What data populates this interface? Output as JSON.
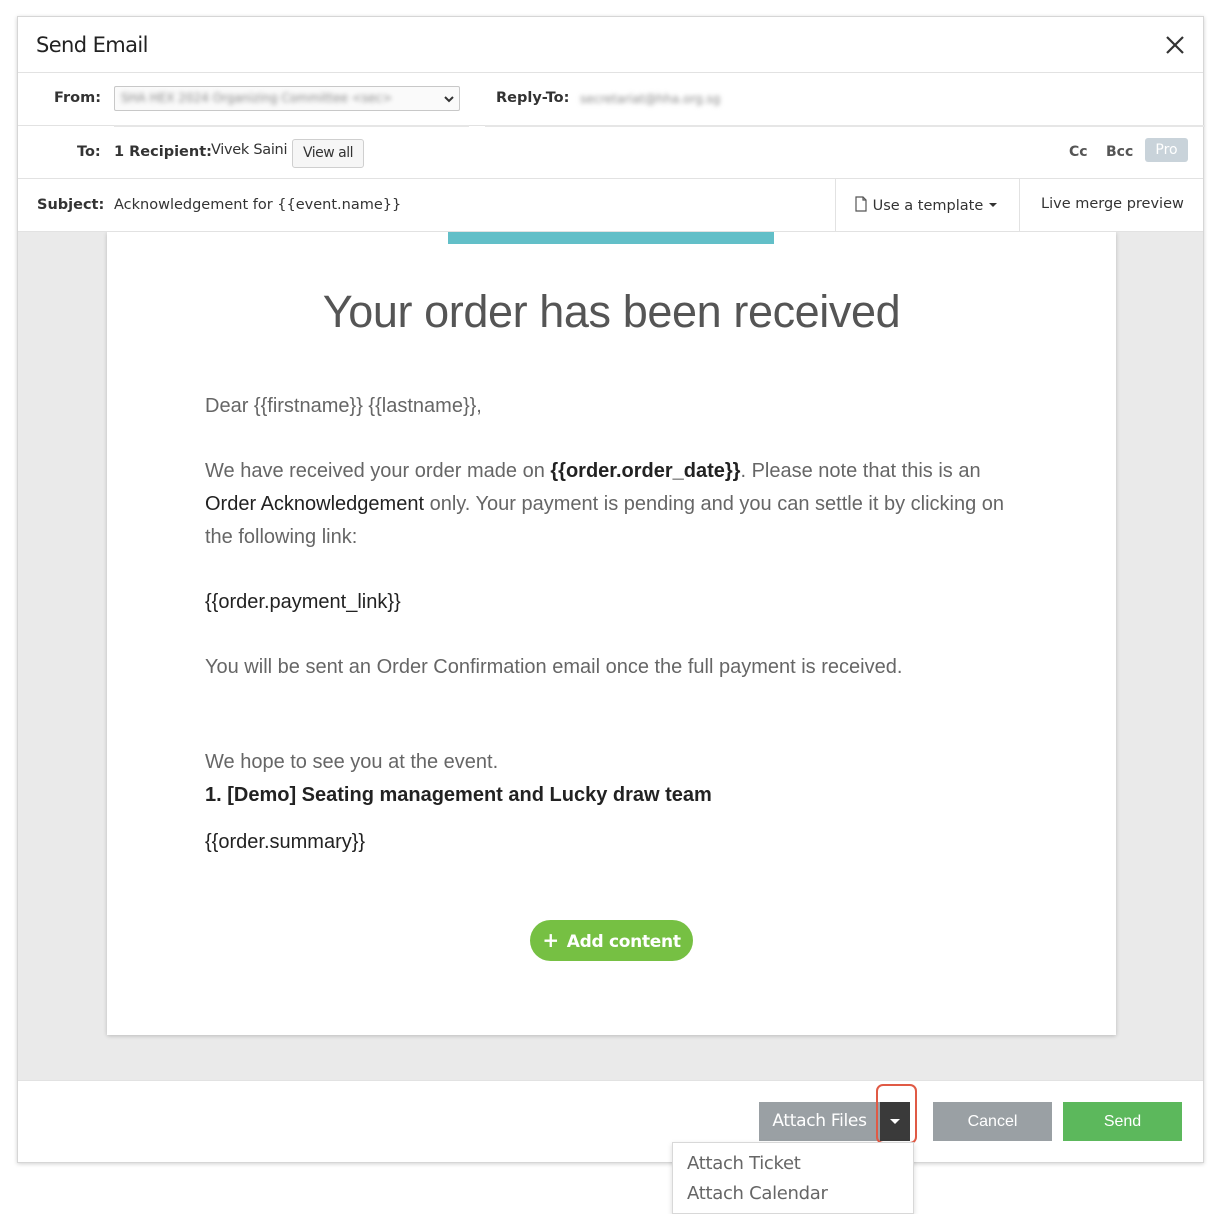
{
  "modal": {
    "title": "Send Email"
  },
  "from": {
    "label": "From:",
    "value": "SHA HEX 2024 Organizing Committee <sec>"
  },
  "reply_to": {
    "label": "Reply-To:",
    "value": "secretariat@hha.org.sg"
  },
  "to": {
    "label": "To:",
    "recipient_count": "1 Recipient:",
    "recipient_name": "Vivek Saini",
    "view_all": "View all",
    "cc": "Cc",
    "bcc": "Bcc",
    "pro_badge": "Pro"
  },
  "subject": {
    "label": "Subject:",
    "value": "Acknowledgement for {{event.name}}",
    "use_template": "Use a template",
    "live_merge": "Live merge preview"
  },
  "email": {
    "title": "Your order has been received",
    "greeting": "Dear {{firstname}} {{lastname}},",
    "para1_a": "We have received your order made on ",
    "para1_b": "{{order.order_date}}",
    "para1_c": ". Please note that this is an ",
    "para1_d": "Order Acknowledgement",
    "para1_e": " only. Your payment is pending and you can settle it by clicking on the following link:",
    "payment_link": "{{order.payment_link}}",
    "confirmation": "You will be sent an Order Confirmation email once the full payment is received.",
    "hope": "We hope to see you at the event.",
    "team": "1. [Demo] Seating management and Lucky draw team",
    "summary": "{{order.summary}}",
    "add_content": "Add content"
  },
  "footer": {
    "attach_files": "Attach Files",
    "cancel": "Cancel",
    "send": "Send"
  },
  "attach_menu": [
    "Attach Ticket",
    "Attach Calendar"
  ],
  "icons": {
    "close": "close-icon",
    "template": "document-icon",
    "caret": "caret-down-icon",
    "plus": "plus-icon"
  }
}
